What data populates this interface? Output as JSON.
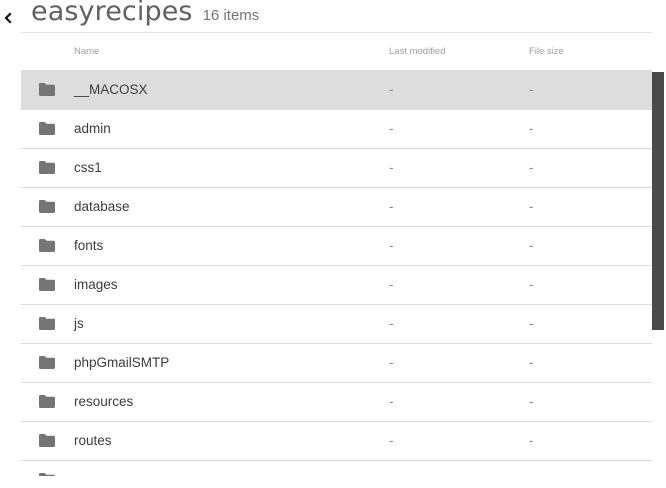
{
  "header": {
    "title": "easyrecipes",
    "count": "16 items"
  },
  "columns": {
    "name": "Name",
    "modified": "Last modified",
    "size": "File size"
  },
  "rows": [
    {
      "name": "__MACOSX",
      "modified": "-",
      "size": "-"
    },
    {
      "name": "admin",
      "modified": "-",
      "size": "-"
    },
    {
      "name": "css1",
      "modified": "-",
      "size": "-"
    },
    {
      "name": "database",
      "modified": "-",
      "size": "-"
    },
    {
      "name": "fonts",
      "modified": "-",
      "size": "-"
    },
    {
      "name": "images",
      "modified": "-",
      "size": "-"
    },
    {
      "name": "js",
      "modified": "-",
      "size": "-"
    },
    {
      "name": "phpGmailSMTP",
      "modified": "-",
      "size": "-"
    },
    {
      "name": "resources",
      "modified": "-",
      "size": "-"
    },
    {
      "name": "routes",
      "modified": "-",
      "size": "-"
    },
    {
      "name": "",
      "modified": "",
      "size": ""
    }
  ],
  "icons": {
    "back": "chevron-left-icon",
    "folder": "folder-icon"
  },
  "colors": {
    "selected_row": "#dddddd",
    "folder": "#757575",
    "scrollbar": "#4a4a4a"
  }
}
